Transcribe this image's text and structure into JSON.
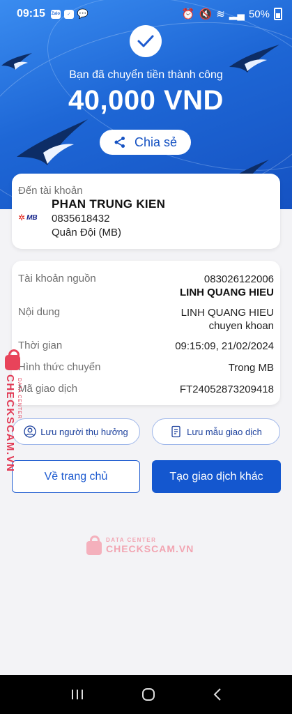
{
  "status_bar": {
    "time": "09:15",
    "battery": "50%",
    "app_badge": "Zalo"
  },
  "header": {
    "success_text": "Bạn đã chuyển tiền thành công",
    "amount": "40,000 VND",
    "share_label": "Chia sẻ"
  },
  "recipient": {
    "to_label": "Đến tài khoản",
    "bank_logo_text": "MB",
    "name": "PHAN TRUNG KIEN",
    "account": "0835618432",
    "bank": "Quân Đội (MB)"
  },
  "details": [
    {
      "label": "Tài khoản nguồn",
      "value": "083026122006",
      "value2": "LINH QUANG HIEU"
    },
    {
      "label": "Nội dung",
      "value": "LINH QUANG HIEU",
      "value2": "chuyen khoan"
    },
    {
      "label": "Thời gian",
      "value": "09:15:09, 21/02/2024"
    },
    {
      "label": "Hình thức chuyển",
      "value": "Trong MB"
    },
    {
      "label": "Mã giao dịch",
      "value": "FT24052873209418"
    }
  ],
  "actions": {
    "save_recipient": "Lưu người thụ hưởng",
    "save_template": "Lưu mẫu giao dịch",
    "home": "Về trang chủ",
    "new_transaction": "Tạo giao dịch khác"
  },
  "watermark": {
    "brand": "CHECKSCAM.VN",
    "sub": "DATA CENTER"
  },
  "colors": {
    "primary": "#1457cf",
    "header_gradient_start": "#3a8cf0",
    "watermark": "#e23a55"
  }
}
